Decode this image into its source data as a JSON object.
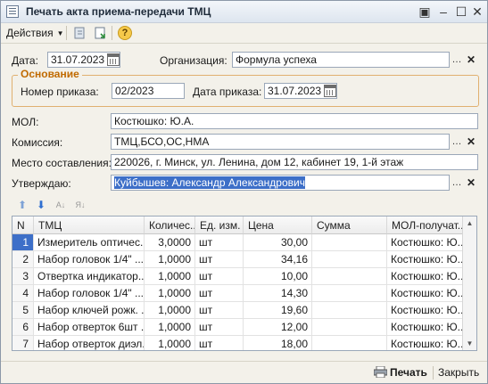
{
  "window": {
    "title": "Печать акта приема-передачи ТМЦ"
  },
  "toolbar": {
    "actions_label": "Действия"
  },
  "form": {
    "date_label": "Дата:",
    "date_value": "31.07.2023",
    "org_label": "Организация:",
    "org_value": "Формула успеха",
    "group_title": "Основание",
    "order_num_label": "Номер приказа:",
    "order_num_value": "02/2023",
    "order_date_label": "Дата приказа:",
    "order_date_value": "31.07.2023",
    "mol_label": "МОЛ:",
    "mol_value": "Костюшко: Ю.А.",
    "commission_label": "Комиссия:",
    "commission_value": "ТМЦ,БСО,ОС,НМА",
    "place_label": "Место составления:",
    "place_value": "220026, г. Минск, ул. Ленина, дом 12, кабинет 19, 1-й этаж",
    "approve_label": "Утверждаю:",
    "approve_value": "Куйбышев: Александр Александрович"
  },
  "table": {
    "columns": [
      "N",
      "ТМЦ",
      "Количес...",
      "Ед. изм.",
      "Цена",
      "Сумма",
      "МОЛ-получат..."
    ],
    "rows": [
      {
        "n": "1",
        "item": "Измеритель оптичес...",
        "qty": "3,0000",
        "unit": "шт",
        "price": "30,00",
        "sum": "",
        "mol": "Костюшко: Ю..."
      },
      {
        "n": "2",
        "item": "Набор головок 1/4\" ...",
        "qty": "1,0000",
        "unit": "шт",
        "price": "34,16",
        "sum": "",
        "mol": "Костюшко: Ю..."
      },
      {
        "n": "3",
        "item": "Отвертка индикатор...",
        "qty": "1,0000",
        "unit": "шт",
        "price": "10,00",
        "sum": "",
        "mol": "Костюшко: Ю..."
      },
      {
        "n": "4",
        "item": "Набор головок 1/4\" ...",
        "qty": "1,0000",
        "unit": "шт",
        "price": "14,30",
        "sum": "",
        "mol": "Костюшко: Ю..."
      },
      {
        "n": "5",
        "item": "Набор ключей рожк. ...",
        "qty": "1,0000",
        "unit": "шт",
        "price": "19,60",
        "sum": "",
        "mol": "Костюшко: Ю..."
      },
      {
        "n": "6",
        "item": "Набор отверток 6шт ...",
        "qty": "1,0000",
        "unit": "шт",
        "price": "12,00",
        "sum": "",
        "mol": "Костюшко: Ю..."
      },
      {
        "n": "7",
        "item": "Набор отверток диэл...",
        "qty": "1,0000",
        "unit": "шт",
        "price": "18,00",
        "sum": "",
        "mol": "Костюшко: Ю..."
      }
    ]
  },
  "footer": {
    "print_label": "Печать",
    "close_label": "Закрыть"
  },
  "colors": {
    "accent_group": "#c06a00",
    "selection": "#3d6fc8"
  }
}
